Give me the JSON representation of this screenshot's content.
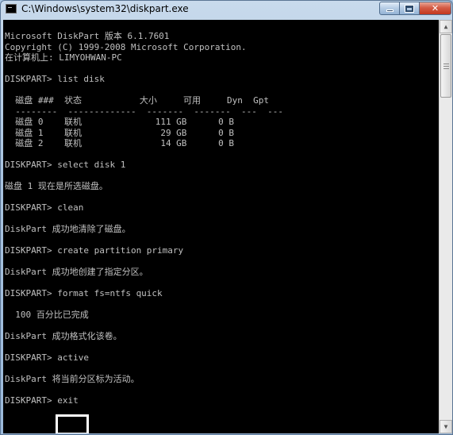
{
  "window": {
    "title": "C:\\Windows\\system32\\diskpart.exe",
    "accent": "#a9c3df"
  },
  "console": {
    "text_color": "#c0c0c0",
    "background": "#000000",
    "lines": [
      "Microsoft DiskPart 版本 6.1.7601",
      "Copyright (C) 1999-2008 Microsoft Corporation.",
      "在计算机上: LIMYOHWAN-PC",
      "",
      "DISKPART> list disk",
      "",
      "  磁盘 ###  状态           大小     可用     Dyn  Gpt",
      "  --------  -------------  -------  -------  ---  ---",
      "  磁盘 0    联机              111 GB      0 B",
      "  磁盘 1    联机               29 GB      0 B",
      "  磁盘 2    联机               14 GB      0 B",
      "",
      "DISKPART> select disk 1",
      "",
      "磁盘 1 现在是所选磁盘。",
      "",
      "DISKPART> clean",
      "",
      "DiskPart 成功地清除了磁盘。",
      "",
      "DISKPART> create partition primary",
      "",
      "DiskPart 成功地创建了指定分区。",
      "",
      "DISKPART> format fs=ntfs quick",
      "",
      "  100 百分比已完成",
      "",
      "DiskPart 成功格式化该卷。",
      "",
      "DISKPART> active",
      "",
      "DiskPart 将当前分区标为活动。",
      "",
      "DISKPART> exit"
    ]
  }
}
